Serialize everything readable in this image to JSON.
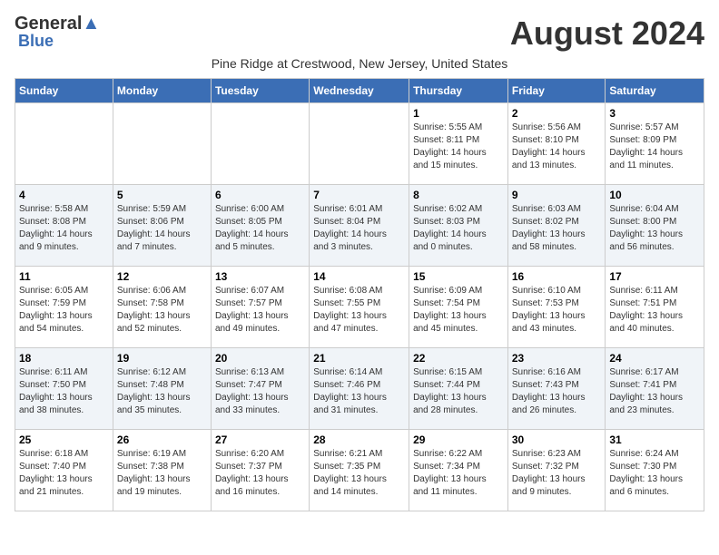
{
  "logo": {
    "line1": "General",
    "line2": "Blue"
  },
  "title": "August 2024",
  "subtitle": "Pine Ridge at Crestwood, New Jersey, United States",
  "days_of_week": [
    "Sunday",
    "Monday",
    "Tuesday",
    "Wednesday",
    "Thursday",
    "Friday",
    "Saturday"
  ],
  "weeks": [
    [
      {
        "day": "",
        "info": ""
      },
      {
        "day": "",
        "info": ""
      },
      {
        "day": "",
        "info": ""
      },
      {
        "day": "",
        "info": ""
      },
      {
        "day": "1",
        "info": "Sunrise: 5:55 AM\nSunset: 8:11 PM\nDaylight: 14 hours\nand 15 minutes."
      },
      {
        "day": "2",
        "info": "Sunrise: 5:56 AM\nSunset: 8:10 PM\nDaylight: 14 hours\nand 13 minutes."
      },
      {
        "day": "3",
        "info": "Sunrise: 5:57 AM\nSunset: 8:09 PM\nDaylight: 14 hours\nand 11 minutes."
      }
    ],
    [
      {
        "day": "4",
        "info": "Sunrise: 5:58 AM\nSunset: 8:08 PM\nDaylight: 14 hours\nand 9 minutes."
      },
      {
        "day": "5",
        "info": "Sunrise: 5:59 AM\nSunset: 8:06 PM\nDaylight: 14 hours\nand 7 minutes."
      },
      {
        "day": "6",
        "info": "Sunrise: 6:00 AM\nSunset: 8:05 PM\nDaylight: 14 hours\nand 5 minutes."
      },
      {
        "day": "7",
        "info": "Sunrise: 6:01 AM\nSunset: 8:04 PM\nDaylight: 14 hours\nand 3 minutes."
      },
      {
        "day": "8",
        "info": "Sunrise: 6:02 AM\nSunset: 8:03 PM\nDaylight: 14 hours\nand 0 minutes."
      },
      {
        "day": "9",
        "info": "Sunrise: 6:03 AM\nSunset: 8:02 PM\nDaylight: 13 hours\nand 58 minutes."
      },
      {
        "day": "10",
        "info": "Sunrise: 6:04 AM\nSunset: 8:00 PM\nDaylight: 13 hours\nand 56 minutes."
      }
    ],
    [
      {
        "day": "11",
        "info": "Sunrise: 6:05 AM\nSunset: 7:59 PM\nDaylight: 13 hours\nand 54 minutes."
      },
      {
        "day": "12",
        "info": "Sunrise: 6:06 AM\nSunset: 7:58 PM\nDaylight: 13 hours\nand 52 minutes."
      },
      {
        "day": "13",
        "info": "Sunrise: 6:07 AM\nSunset: 7:57 PM\nDaylight: 13 hours\nand 49 minutes."
      },
      {
        "day": "14",
        "info": "Sunrise: 6:08 AM\nSunset: 7:55 PM\nDaylight: 13 hours\nand 47 minutes."
      },
      {
        "day": "15",
        "info": "Sunrise: 6:09 AM\nSunset: 7:54 PM\nDaylight: 13 hours\nand 45 minutes."
      },
      {
        "day": "16",
        "info": "Sunrise: 6:10 AM\nSunset: 7:53 PM\nDaylight: 13 hours\nand 43 minutes."
      },
      {
        "day": "17",
        "info": "Sunrise: 6:11 AM\nSunset: 7:51 PM\nDaylight: 13 hours\nand 40 minutes."
      }
    ],
    [
      {
        "day": "18",
        "info": "Sunrise: 6:11 AM\nSunset: 7:50 PM\nDaylight: 13 hours\nand 38 minutes."
      },
      {
        "day": "19",
        "info": "Sunrise: 6:12 AM\nSunset: 7:48 PM\nDaylight: 13 hours\nand 35 minutes."
      },
      {
        "day": "20",
        "info": "Sunrise: 6:13 AM\nSunset: 7:47 PM\nDaylight: 13 hours\nand 33 minutes."
      },
      {
        "day": "21",
        "info": "Sunrise: 6:14 AM\nSunset: 7:46 PM\nDaylight: 13 hours\nand 31 minutes."
      },
      {
        "day": "22",
        "info": "Sunrise: 6:15 AM\nSunset: 7:44 PM\nDaylight: 13 hours\nand 28 minutes."
      },
      {
        "day": "23",
        "info": "Sunrise: 6:16 AM\nSunset: 7:43 PM\nDaylight: 13 hours\nand 26 minutes."
      },
      {
        "day": "24",
        "info": "Sunrise: 6:17 AM\nSunset: 7:41 PM\nDaylight: 13 hours\nand 23 minutes."
      }
    ],
    [
      {
        "day": "25",
        "info": "Sunrise: 6:18 AM\nSunset: 7:40 PM\nDaylight: 13 hours\nand 21 minutes."
      },
      {
        "day": "26",
        "info": "Sunrise: 6:19 AM\nSunset: 7:38 PM\nDaylight: 13 hours\nand 19 minutes."
      },
      {
        "day": "27",
        "info": "Sunrise: 6:20 AM\nSunset: 7:37 PM\nDaylight: 13 hours\nand 16 minutes."
      },
      {
        "day": "28",
        "info": "Sunrise: 6:21 AM\nSunset: 7:35 PM\nDaylight: 13 hours\nand 14 minutes."
      },
      {
        "day": "29",
        "info": "Sunrise: 6:22 AM\nSunset: 7:34 PM\nDaylight: 13 hours\nand 11 minutes."
      },
      {
        "day": "30",
        "info": "Sunrise: 6:23 AM\nSunset: 7:32 PM\nDaylight: 13 hours\nand 9 minutes."
      },
      {
        "day": "31",
        "info": "Sunrise: 6:24 AM\nSunset: 7:30 PM\nDaylight: 13 hours\nand 6 minutes."
      }
    ]
  ]
}
